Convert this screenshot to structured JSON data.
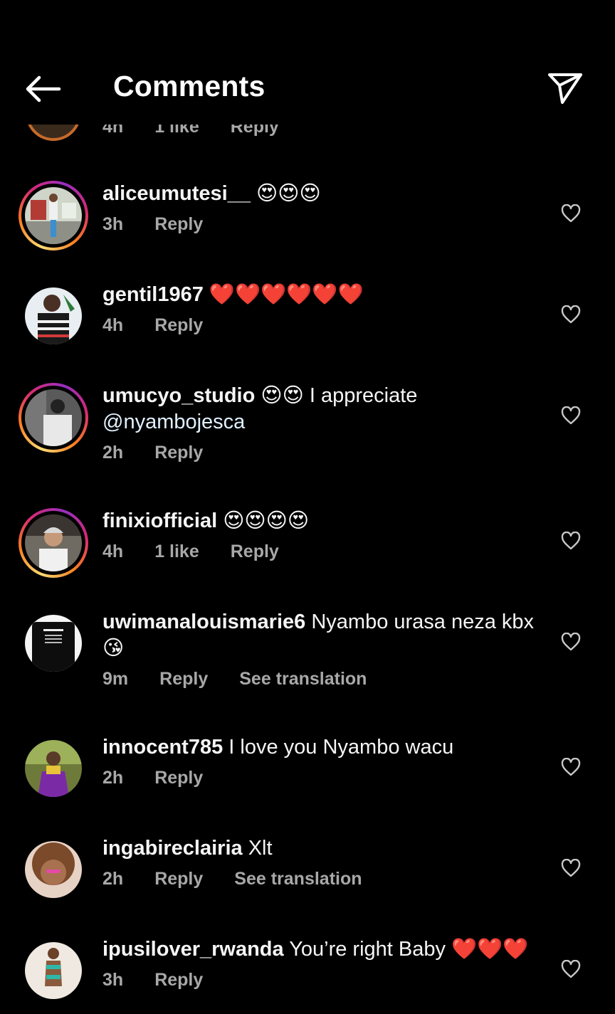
{
  "header": {
    "title": "Comments",
    "back_icon": "back-arrow-icon",
    "share_icon": "send-icon"
  },
  "peek": {
    "time": "4h",
    "likes": "1 like",
    "reply": "Reply"
  },
  "comments": [
    {
      "user": "aliceumutesi__",
      "text": "😍😍😍",
      "mention": "",
      "time": "3h",
      "likes": "",
      "reply": "Reply",
      "translate": ""
    },
    {
      "user": "gentil1967",
      "text": "❤️❤️❤️❤️❤️❤️",
      "mention": "",
      "time": "4h",
      "likes": "",
      "reply": "Reply",
      "translate": ""
    },
    {
      "user": "umucyo_studio",
      "text": "😍😍 I appreciate",
      "mention": "@nyambojesca",
      "time": "2h",
      "likes": "",
      "reply": "Reply",
      "translate": ""
    },
    {
      "user": "finixiofficial",
      "text": "😍😍😍😍",
      "mention": "",
      "time": "4h",
      "likes": "1 like",
      "reply": "Reply",
      "translate": ""
    },
    {
      "user": "uwimanalouismarie6",
      "text": "Nyambo urasa neza kbx 😘",
      "mention": "",
      "time": "9m",
      "likes": "",
      "reply": "Reply",
      "translate": "See translation"
    },
    {
      "user": "innocent785",
      "text": "I love you Nyambo wacu",
      "mention": "",
      "time": "2h",
      "likes": "",
      "reply": "Reply",
      "translate": ""
    },
    {
      "user": "ingabireclairia",
      "text": "Xlt",
      "mention": "",
      "time": "2h",
      "likes": "",
      "reply": "Reply",
      "translate": "See translation"
    },
    {
      "user": "ipusilover_rwanda",
      "text": "You’re right Baby ❤️❤️❤️",
      "mention": "",
      "time": "3h",
      "likes": "",
      "reply": "Reply",
      "translate": ""
    }
  ],
  "colors": {
    "background": "#000000",
    "text": "#f5f5f5",
    "meta": "#a8a8a8",
    "mention": "#e0f1ff"
  },
  "icons": {
    "like": "heart-outline-icon"
  }
}
